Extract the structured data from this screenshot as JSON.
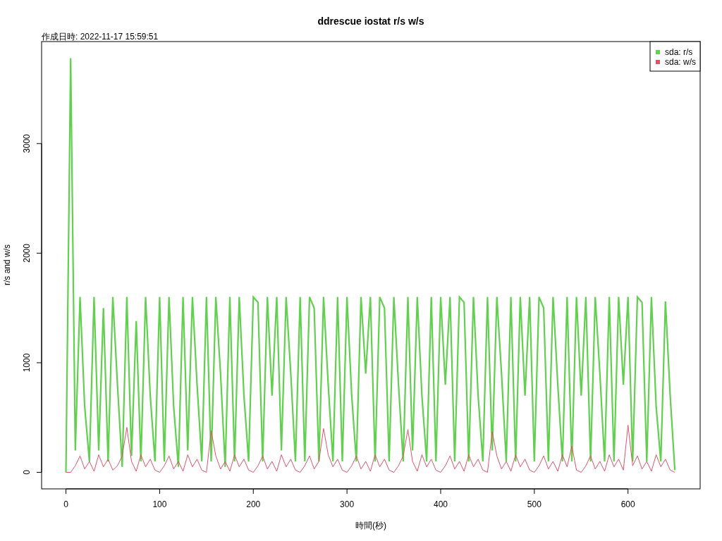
{
  "subtitle": "作成日時: 2022-11-17 15:59:51",
  "chart_data": {
    "type": "line",
    "title": "ddrescue iostat r/s w/s",
    "xlabel": "時間(秒)",
    "ylabel": "r/s and w/s",
    "xlim": [
      -26,
      677
    ],
    "ylim": [
      -151,
      3931
    ],
    "xticks": [
      0,
      100,
      200,
      300,
      400,
      500,
      600
    ],
    "yticks": [
      0,
      1000,
      2000,
      3000
    ],
    "legend": true,
    "x": [
      0,
      5,
      10,
      15,
      20,
      25,
      30,
      35,
      40,
      45,
      50,
      55,
      60,
      65,
      70,
      75,
      80,
      85,
      90,
      95,
      100,
      105,
      110,
      115,
      120,
      125,
      130,
      135,
      140,
      145,
      150,
      155,
      160,
      165,
      170,
      175,
      180,
      185,
      190,
      195,
      200,
      205,
      210,
      215,
      220,
      225,
      230,
      235,
      240,
      245,
      250,
      255,
      260,
      265,
      270,
      275,
      280,
      285,
      290,
      295,
      300,
      305,
      310,
      315,
      320,
      325,
      330,
      335,
      340,
      345,
      350,
      355,
      360,
      365,
      370,
      375,
      380,
      385,
      390,
      395,
      400,
      405,
      410,
      415,
      420,
      425,
      430,
      435,
      440,
      445,
      450,
      455,
      460,
      465,
      470,
      475,
      480,
      485,
      490,
      495,
      500,
      505,
      510,
      515,
      520,
      525,
      530,
      535,
      540,
      545,
      550,
      555,
      560,
      565,
      570,
      575,
      580,
      585,
      590,
      595,
      600,
      605,
      610,
      615,
      620,
      625,
      630,
      635,
      640,
      645,
      650
    ],
    "series": [
      {
        "name": "sda: r/s",
        "color": "#61d04f",
        "values": [
          0,
          3780,
          200,
          1600,
          600,
          100,
          1600,
          200,
          1500,
          100,
          1600,
          800,
          50,
          1600,
          150,
          1380,
          100,
          1600,
          700,
          100,
          1600,
          100,
          1600,
          600,
          50,
          1600,
          200,
          1600,
          800,
          100,
          1600,
          100,
          1600,
          900,
          50,
          1600,
          100,
          1600,
          700,
          100,
          1600,
          1550,
          100,
          1600,
          700,
          1600,
          200,
          1600,
          900,
          100,
          1600,
          100,
          1600,
          1500,
          100,
          1600,
          800,
          100,
          1600,
          100,
          1600,
          700,
          100,
          1600,
          900,
          1600,
          100,
          1600,
          1500,
          100,
          1600,
          800,
          100,
          1600,
          200,
          1600,
          700,
          100,
          1600,
          100,
          1600,
          800,
          1600,
          100,
          1600,
          1550,
          100,
          1600,
          700,
          100,
          1600,
          200,
          1600,
          900,
          100,
          1600,
          100,
          1600,
          700,
          1600,
          100,
          1600,
          1500,
          100,
          1600,
          800,
          100,
          1600,
          100,
          1600,
          700,
          1600,
          100,
          1600,
          900,
          100,
          1600,
          100,
          1600,
          800,
          1600,
          100,
          1600,
          1550,
          100,
          1600,
          600,
          100,
          1560,
          700,
          20
        ]
      },
      {
        "name": "sda: w/s",
        "color": "#df536b",
        "values": [
          0,
          0,
          60,
          150,
          30,
          100,
          10,
          160,
          50,
          120,
          20,
          60,
          150,
          410,
          100,
          10,
          160,
          50,
          120,
          20,
          0,
          60,
          150,
          30,
          100,
          10,
          160,
          50,
          120,
          20,
          0,
          380,
          150,
          30,
          100,
          10,
          160,
          50,
          120,
          20,
          0,
          60,
          150,
          30,
          100,
          10,
          160,
          50,
          120,
          20,
          0,
          60,
          150,
          30,
          100,
          400,
          160,
          50,
          120,
          20,
          0,
          60,
          150,
          30,
          100,
          10,
          160,
          50,
          120,
          20,
          0,
          60,
          150,
          390,
          100,
          10,
          160,
          50,
          120,
          20,
          0,
          60,
          150,
          30,
          100,
          10,
          160,
          50,
          120,
          20,
          0,
          370,
          150,
          30,
          100,
          10,
          160,
          50,
          120,
          20,
          0,
          60,
          150,
          30,
          100,
          10,
          160,
          50,
          240,
          20,
          0,
          60,
          150,
          30,
          100,
          10,
          160,
          50,
          120,
          20,
          430,
          60,
          150,
          30,
          100,
          10,
          160,
          50,
          120,
          20,
          0
        ]
      }
    ]
  }
}
